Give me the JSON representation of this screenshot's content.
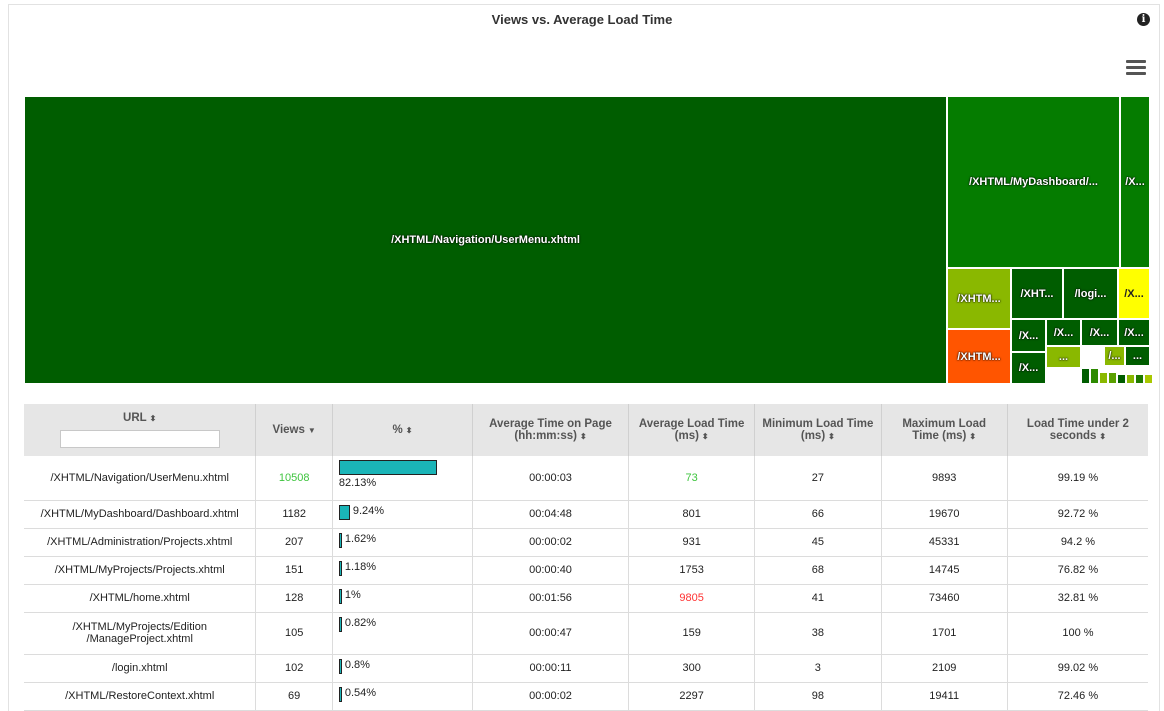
{
  "chart_data": [
    {
      "type": "treemap",
      "title": "Views vs. Average Load Time",
      "tiles": [
        {
          "label": "/XHTML/Navigation/UserMenu.xhtml",
          "color": "#005d00"
        },
        {
          "label": "/XHTML/MyDashboard/...",
          "color": "#057c00"
        },
        {
          "label": "/X...",
          "color": "#057c00"
        },
        {
          "label": "/XHTM...",
          "color": "#8ab800"
        },
        {
          "label": "/XHT...",
          "color": "#005d00"
        },
        {
          "label": "/logi...",
          "color": "#005d00"
        },
        {
          "label": "/X...",
          "color": "#ffff00"
        },
        {
          "label": "/XHTM...",
          "color": "#ff5500"
        },
        {
          "label": "/X...",
          "color": "#005d00"
        },
        {
          "label": "/X...",
          "color": "#005d00"
        },
        {
          "label": "/X...",
          "color": "#005d00"
        },
        {
          "label": "/X...",
          "color": "#005d00"
        },
        {
          "label": "...",
          "color": "#8ab800"
        },
        {
          "label": "/...",
          "color": "#8ab800"
        },
        {
          "label": "...",
          "color": "#005d00"
        }
      ]
    },
    {
      "type": "table",
      "columns": [
        {
          "label": "URL",
          "sort": "both",
          "filter": true
        },
        {
          "label": "Views",
          "sort": "desc"
        },
        {
          "label": "%",
          "sort": "both"
        },
        {
          "label": "Average Time on Page (hh:mm:ss)",
          "sort": "both"
        },
        {
          "label": "Average Load Time (ms)",
          "sort": "both"
        },
        {
          "label": "Minimum Load Time (ms)",
          "sort": "both"
        },
        {
          "label": "Maximum Load Time (ms)",
          "sort": "both"
        },
        {
          "label": "Load Time under 2 seconds",
          "sort": "both"
        }
      ],
      "rows": [
        {
          "url": "/XHTML/Navigation/UserMenu.xhtml",
          "views": "10508",
          "pct": 82.13,
          "pct_label": "82.13%",
          "avg_time": "00:00:03",
          "avg_load": "73",
          "min_load": "27",
          "max_load": "9893",
          "under2s": "99.19 %",
          "views_color": "#3ec43e",
          "load_color": "#3ec43e"
        },
        {
          "url": "/XHTML/MyDashboard/Dashboard.xhtml",
          "views": "1182",
          "pct": 9.24,
          "pct_label": "9.24%",
          "avg_time": "00:04:48",
          "avg_load": "801",
          "min_load": "66",
          "max_load": "19670",
          "under2s": "92.72 %"
        },
        {
          "url": "/XHTML/Administration/Projects.xhtml",
          "views": "207",
          "pct": 1.62,
          "pct_label": "1.62%",
          "avg_time": "00:00:02",
          "avg_load": "931",
          "min_load": "45",
          "max_load": "45331",
          "under2s": "94.2 %"
        },
        {
          "url": "/XHTML/MyProjects/Projects.xhtml",
          "views": "151",
          "pct": 1.18,
          "pct_label": "1.18%",
          "avg_time": "00:00:40",
          "avg_load": "1753",
          "min_load": "68",
          "max_load": "14745",
          "under2s": "76.82 %"
        },
        {
          "url": "/XHTML/home.xhtml",
          "views": "128",
          "pct": 1,
          "pct_label": "1%",
          "avg_time": "00:01:56",
          "avg_load": "9805",
          "min_load": "41",
          "max_load": "73460",
          "under2s": "32.81 %",
          "load_color": "#ff3333"
        },
        {
          "url": "/XHTML/MyProjects/Edition /ManageProject.xhtml",
          "views": "105",
          "pct": 0.82,
          "pct_label": "0.82%",
          "avg_time": "00:00:47",
          "avg_load": "159",
          "min_load": "38",
          "max_load": "1701",
          "under2s": "100 %"
        },
        {
          "url": "/login.xhtml",
          "views": "102",
          "pct": 0.8,
          "pct_label": "0.8%",
          "avg_time": "00:00:11",
          "avg_load": "300",
          "min_load": "3",
          "max_load": "2109",
          "under2s": "99.02 %"
        },
        {
          "url": "/XHTML/RestoreContext.xhtml",
          "views": "69",
          "pct": 0.54,
          "pct_label": "0.54%",
          "avg_time": "00:00:02",
          "avg_load": "2297",
          "min_load": "98",
          "max_load": "19411",
          "under2s": "72.46 %"
        }
      ]
    }
  ],
  "icons": {
    "info": "info-icon",
    "menu": "hamburger-menu-icon"
  },
  "colors": {
    "bar": "#1ab5b8"
  }
}
